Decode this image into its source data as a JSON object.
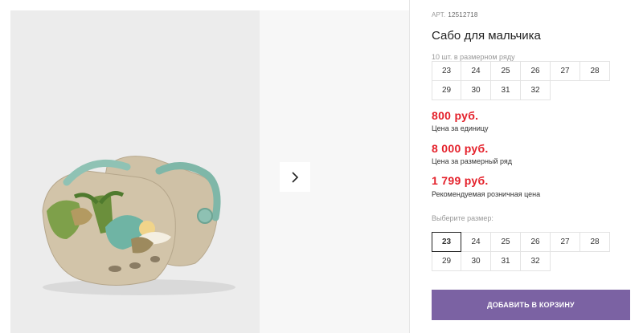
{
  "product": {
    "art_label": "АРТ.",
    "art_value": "12512718",
    "title": "Сабо для мальчика",
    "pack_caption": "10 шт. в размерном ряду",
    "pack_sizes": [
      "23",
      "24",
      "25",
      "26",
      "27",
      "28",
      "29",
      "30",
      "31",
      "32"
    ]
  },
  "prices": {
    "unit_price": "800 руб.",
    "unit_label": "Цена за единицу",
    "pack_price": "8 000 руб.",
    "pack_label": "Цена за размерный ряд",
    "retail_price": "1 799 руб.",
    "retail_label": "Рекомендуемая розничная цена"
  },
  "size_select": {
    "label": "Выберите размер:",
    "sizes": [
      "23",
      "24",
      "25",
      "26",
      "27",
      "28",
      "29",
      "30",
      "31",
      "32"
    ],
    "selected": "23"
  },
  "actions": {
    "add_to_cart": "ДОБАВИТЬ В КОРЗИНУ"
  },
  "gallery": {
    "next_icon": "chevron-right-icon"
  },
  "colors": {
    "price": "#e4202a",
    "button": "#7b62a3"
  }
}
